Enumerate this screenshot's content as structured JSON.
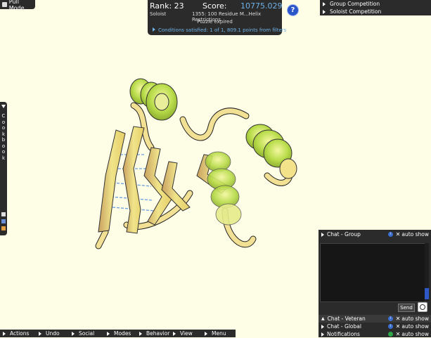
{
  "pull_mode": {
    "label": "Pull Mode"
  },
  "score_panel": {
    "rank_label": "Rank: 23",
    "score_label": "Score:",
    "score_value": "10775.029",
    "mode": "Soloist",
    "puzzle_name": "1355: 100 Residue M...Helix Restrictions",
    "status": "Puzzle expired",
    "conditions": "Conditions satisfied: 1 of 1, 809.1 points from filters"
  },
  "help_button": {
    "label": "?"
  },
  "competitions": [
    {
      "label": "Group Competition"
    },
    {
      "label": "Soloist Competition"
    }
  ],
  "cookbook": {
    "label": "Cookbook"
  },
  "chat": {
    "group": {
      "label": "Chat - Group",
      "auto_show": "auto show"
    },
    "send_label": "Send",
    "channels": [
      {
        "label": "Chat - Veteran",
        "auto_show": "auto show"
      },
      {
        "label": "Chat - Global",
        "auto_show": "auto show"
      },
      {
        "label": "Notifications",
        "auto_show": "auto show"
      }
    ]
  },
  "bottom_menu": [
    {
      "label": "Actions"
    },
    {
      "label": "Undo"
    },
    {
      "label": "Social"
    },
    {
      "label": "Modes"
    },
    {
      "label": "Behavior"
    },
    {
      "label": "View"
    },
    {
      "label": "Menu"
    }
  ],
  "colors": {
    "background": "#fefde6",
    "panel": "#2b2b2b",
    "accent_blue": "#6fb2e8",
    "helix_green": "#b8dc4a",
    "strand_yellow": "#e8dc7a"
  }
}
